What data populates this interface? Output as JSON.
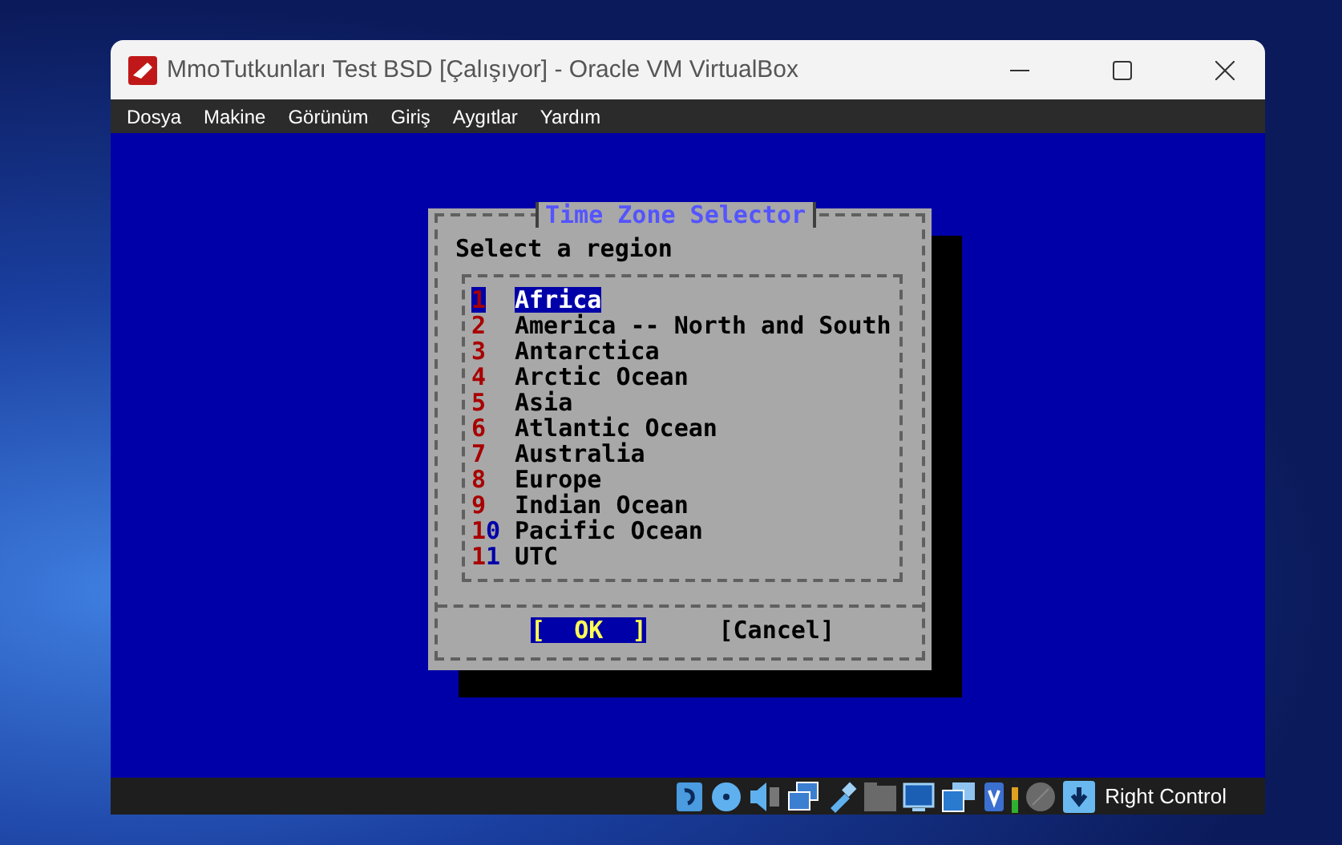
{
  "window": {
    "title": "MmoTutkunları Test BSD [Çalışıyor] - Oracle VM VirtualBox"
  },
  "menu": [
    "Dosya",
    "Makine",
    "Görünüm",
    "Giriş",
    "Aygıtlar",
    "Yardım"
  ],
  "dialog": {
    "title": "Time Zone Selector",
    "prompt": "Select a region",
    "items": [
      {
        "number": "1",
        "label": "Africa",
        "selected": true
      },
      {
        "number": "2",
        "label": "America -- North and South",
        "selected": false
      },
      {
        "number": "3",
        "label": "Antarctica",
        "selected": false
      },
      {
        "number": "4",
        "label": "Arctic Ocean",
        "selected": false
      },
      {
        "number": "5",
        "label": "Asia",
        "selected": false
      },
      {
        "number": "6",
        "label": "Atlantic Ocean",
        "selected": false
      },
      {
        "number": "7",
        "label": "Australia",
        "selected": false
      },
      {
        "number": "8",
        "label": "Europe",
        "selected": false
      },
      {
        "number": "9",
        "label": "Indian Ocean",
        "selected": false
      },
      {
        "number": "10",
        "label": "Pacific Ocean",
        "selected": false
      },
      {
        "number": "11",
        "label": "UTC",
        "selected": false
      }
    ],
    "buttons": [
      {
        "label": "[  OK  ]",
        "selected": true
      },
      {
        "label": "[Cancel]",
        "selected": false
      }
    ]
  },
  "status_bar": {
    "host_key": "Right Control"
  }
}
